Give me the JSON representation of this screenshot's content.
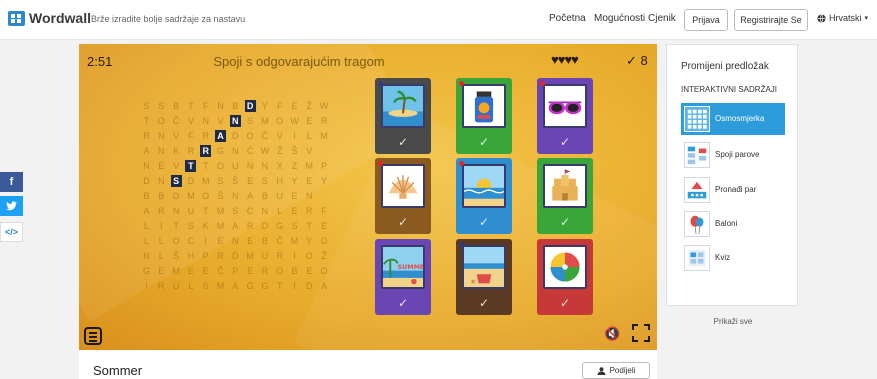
{
  "header": {
    "brand": "Wordwall",
    "tagline": "Brže izradite bolje sadržaje za nastavu",
    "nav": [
      "Početna",
      "Mogućnosti",
      "Cjenik"
    ],
    "login": "Prijava",
    "register": "Registrirajte Se",
    "language": "Hrvatski"
  },
  "social": {
    "facebook": "f",
    "twitter": "t",
    "embed": "</>"
  },
  "game": {
    "timer": "2:51",
    "title": "Spoji s odgovarajućim tragom",
    "hearts": "♥♥♥♥",
    "score": "✓ 8",
    "grid": [
      "SSBTFNBDYFEŽW",
      "TOČVNVNSMOWER",
      "RNVFRADOČVILM",
      "ANKRRGNĆWŽŠV",
      "NEVTTOUNNXZMP",
      "DNSDMSŠESHYEY",
      "BBDMOŠNABUEN",
      "ARNUTMSCNLERF",
      "LITSKMARDGSTE",
      "LLOCIENEBČMYD",
      "NLŠHPRDMURIOŽ",
      "GEMEEČPEROBEO",
      "IRULSMAGGTIDA"
    ],
    "highlighted": [
      "D",
      "N",
      "A",
      "R",
      "T",
      "S"
    ],
    "cards": [
      {
        "picture": "beach-island",
        "bg": "#4a4a4a",
        "marker": "triangle"
      },
      {
        "picture": "sunscreen",
        "bg": "#3aa63a",
        "marker": "dot"
      },
      {
        "picture": "sunglasses",
        "bg": "#6a45b4",
        "marker": "dot"
      },
      {
        "picture": "seashell",
        "bg": "#8a5a1e",
        "marker": "dot"
      },
      {
        "picture": "sea-sun",
        "bg": "#2e8ecf",
        "marker": "dot"
      },
      {
        "picture": "sandcastle",
        "bg": "#3aa63a",
        "marker": "none"
      },
      {
        "picture": "beach-scene",
        "bg": "#6a45b4",
        "marker": "none"
      },
      {
        "picture": "sand-bucket",
        "bg": "#5a3a22",
        "marker": "triangle"
      },
      {
        "picture": "beach-ball",
        "bg": "#c73838",
        "marker": "none"
      }
    ],
    "card_check": "✓",
    "sound_icon": "🔇",
    "menu_icon": "menu-icon",
    "fullscreen_icon": "fullscreen-icon"
  },
  "templates": {
    "title": "Promijeni predložak",
    "subtitle": "INTERAKTIVNI SADRŽAJI",
    "items": [
      {
        "label": "Osmosmjerka",
        "active": true
      },
      {
        "label": "Spoji parove",
        "active": false
      },
      {
        "label": "Pronađi par",
        "active": false
      },
      {
        "label": "Baloni",
        "active": false
      },
      {
        "label": "Kviz",
        "active": false
      }
    ],
    "show_all": "Prikaži sve"
  },
  "activity": {
    "title": "Sommer",
    "share": "Podijeli"
  }
}
